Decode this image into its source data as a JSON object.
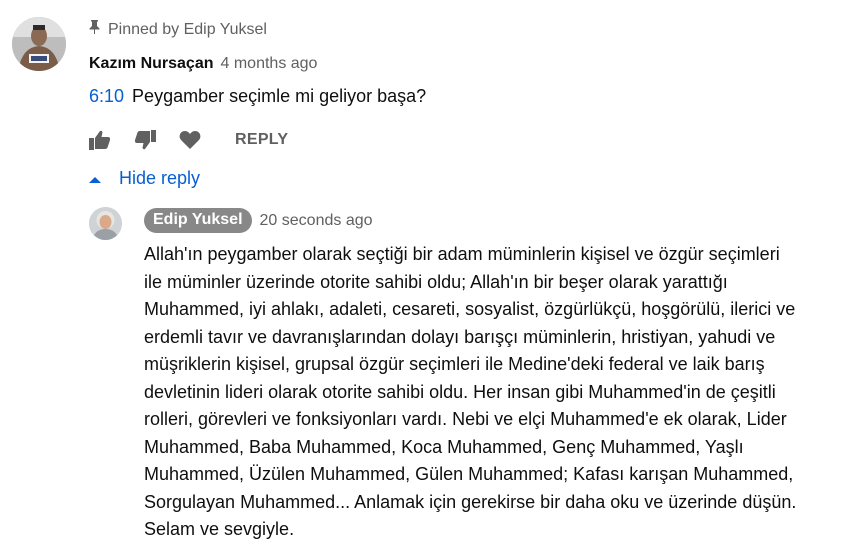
{
  "pinned": {
    "label": "Pinned by Edip Yuksel",
    "icon": "pin-icon"
  },
  "comment": {
    "author": "Kazım Nursaçan",
    "time": "4 months ago",
    "timestamp": "6:10",
    "text": "Peygamber seçimle mi geliyor başa?"
  },
  "actions": {
    "like_icon": "thumbs-up-icon",
    "dislike_icon": "thumbs-down-icon",
    "heart_icon": "heart-icon",
    "reply_label": "REPLY"
  },
  "replies_toggle": {
    "label": "Hide reply",
    "icon": "chevron-up-icon"
  },
  "reply": {
    "author": "Edip Yuksel",
    "time": "20 seconds ago",
    "text_lines": [
      "Allah'ın peygamber olarak seçtiği bir adam müminlerin kişisel ve özgür seçimleri",
      "ile müminler üzerinde otorite sahibi oldu; Allah'ın bir beşer olarak yarattığı",
      "Muhammed, iyi ahlakı, adaleti, cesareti, sosyalist, özgürlükçü, hoşgörülü, ilerici ve",
      "erdemli tavır ve davranışlarından dolayı barışçı müminlerin, hristiyan, yahudi ve",
      "müşriklerin kişisel, grupsal özgür seçimleri ile Medine'deki federal ve laik barış",
      "devletinin lideri olarak otorite sahibi oldu. Her insan gibi Muhammed'in de çeşitli",
      "rolleri, görevleri ve fonksiyonları vardı. Nebi ve elçi Muhammed'e ek olarak, Lider",
      "Muhammed, Baba Muhammed, Koca Muhammed, Genç Muhammed, Yaşlı",
      "Muhammed, Üzülen Muhammed, Gülen Muhammed; Kafası karışan Muhammed,",
      "Sorgulayan Muhammed... Anlamak için gerekirse bir daha oku ve üzerinde düşün.",
      "Selam ve sevgiyle."
    ]
  },
  "colors": {
    "link": "#065fd4",
    "muted": "#606060",
    "chip": "#888888"
  }
}
